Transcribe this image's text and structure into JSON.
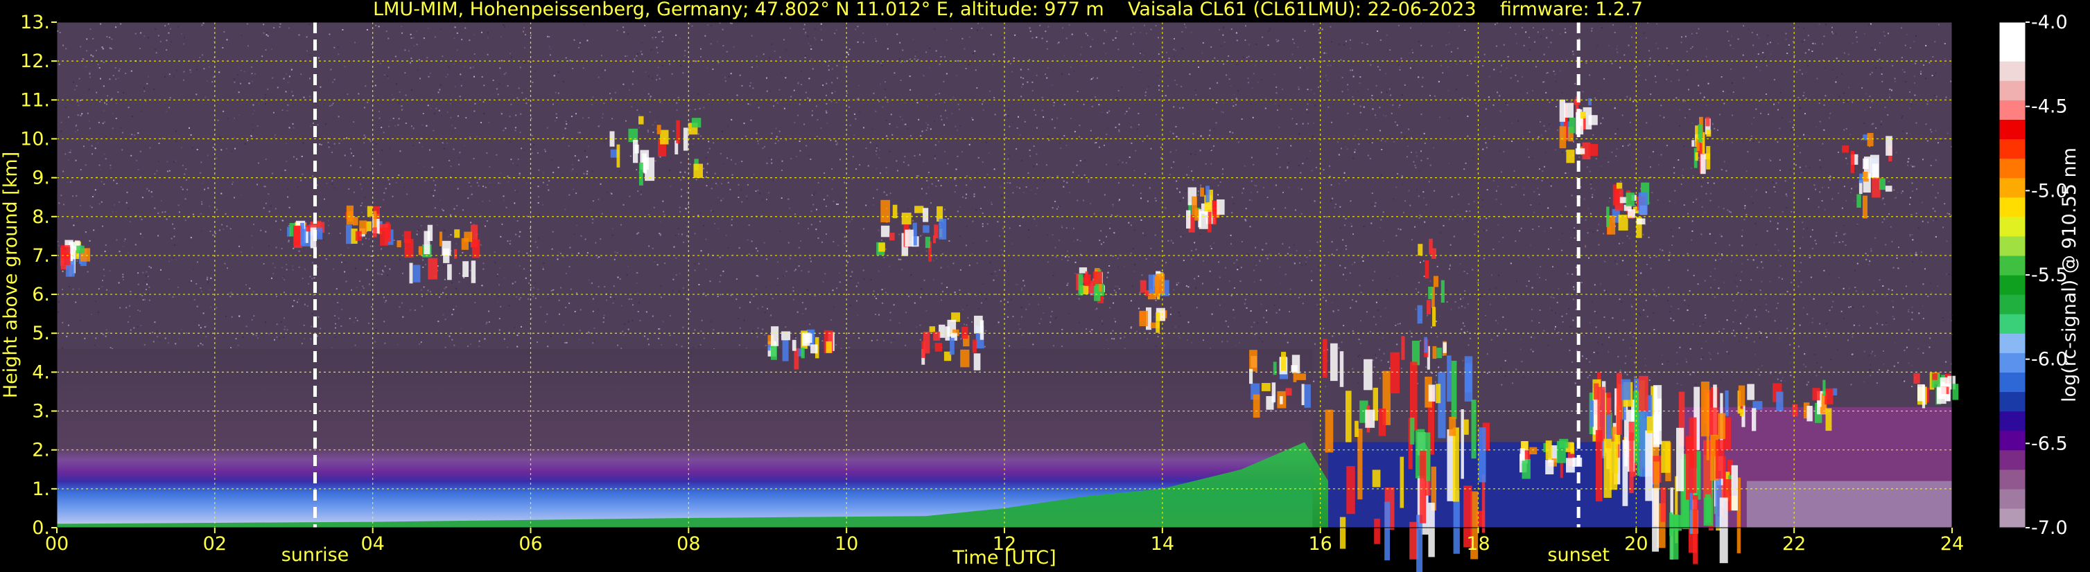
{
  "chart_data": {
    "type": "heatmap",
    "title": "LMU-MIM, Hohenpeissenberg, Germany; 47.802° N 11.012° E, altitude: 977 m    Vaisala CL61 (CL61LMU): 22-06-2023    firmware: 1.2.7",
    "xlabel": "Time [UTC]",
    "ylabel": "Height above ground [km]",
    "xlim": [
      0,
      24
    ],
    "ylim": [
      0,
      13
    ],
    "x_ticks": [
      "00",
      "02",
      "04",
      "06",
      "08",
      "10",
      "12",
      "14",
      "16",
      "18",
      "20",
      "22",
      "24"
    ],
    "y_ticks": [
      "0.",
      "1.",
      "2.",
      "3.",
      "4.",
      "5.",
      "6.",
      "7.",
      "8.",
      "9.",
      "10.",
      "11.",
      "12.",
      "13."
    ],
    "grid": true,
    "grid_color": "#ffff00",
    "events": [
      {
        "label": "sunrise",
        "time_h": 3.27
      },
      {
        "label": "sunset",
        "time_h": 19.27
      }
    ],
    "colorbar": {
      "label": "log(rc-signal) @ 910.55 nm",
      "range": [
        -7.0,
        -4.0
      ],
      "ticks": [
        "-4.0",
        "-4.5",
        "-5.0",
        "-5.5",
        "-6.0",
        "-6.5",
        "-7.0"
      ],
      "colors": [
        "#b59ab5",
        "#a07aa0",
        "#90588f",
        "#7a2b86",
        "#5a0096",
        "#2d0a9c",
        "#1a3aa8",
        "#2e68d6",
        "#5a92ee",
        "#8ab8f4",
        "#3ad07a",
        "#20b040",
        "#10a020",
        "#40c040",
        "#a0e040",
        "#e0f020",
        "#ffdd00",
        "#ffaa00",
        "#ff7700",
        "#ff3300",
        "#ee0000",
        "#ff8080",
        "#f0b0b0",
        "#f0d8d8",
        "#ffffff",
        "#ffffff"
      ]
    },
    "cloud_features": [
      {
        "t0": 0.0,
        "t1": 0.3,
        "h0": 7.0,
        "h1": 7.4,
        "kind": "patch"
      },
      {
        "t0": 2.9,
        "t1": 3.3,
        "h0": 7.7,
        "h1": 7.9,
        "kind": "patch"
      },
      {
        "t0": 3.6,
        "t1": 4.2,
        "h0": 7.6,
        "h1": 8.3,
        "kind": "patch"
      },
      {
        "t0": 4.3,
        "t1": 5.3,
        "h0": 6.6,
        "h1": 7.8,
        "kind": "patch"
      },
      {
        "t0": 7.0,
        "t1": 8.1,
        "h0": 9.3,
        "h1": 10.6,
        "kind": "patch"
      },
      {
        "t0": 9.0,
        "t1": 9.8,
        "h0": 4.6,
        "h1": 5.2,
        "kind": "patch"
      },
      {
        "t0": 10.3,
        "t1": 11.3,
        "h0": 7.3,
        "h1": 8.5,
        "kind": "patch"
      },
      {
        "t0": 10.9,
        "t1": 11.9,
        "h0": 4.4,
        "h1": 5.6,
        "kind": "patch"
      },
      {
        "t0": 12.9,
        "t1": 13.2,
        "h0": 6.2,
        "h1": 6.7,
        "kind": "patch"
      },
      {
        "t0": 13.7,
        "t1": 14.0,
        "h0": 5.1,
        "h1": 6.8,
        "kind": "patch"
      },
      {
        "t0": 14.3,
        "t1": 14.7,
        "h0": 7.9,
        "h1": 8.8,
        "kind": "patch"
      },
      {
        "t0": 15.0,
        "t1": 15.8,
        "h0": 3.3,
        "h1": 4.6,
        "kind": "patch"
      },
      {
        "t0": 16.0,
        "t1": 18.1,
        "h0": 0.0,
        "h1": 5.0,
        "kind": "convective"
      },
      {
        "t0": 17.2,
        "t1": 17.6,
        "h0": 4.5,
        "h1": 7.8,
        "kind": "streak"
      },
      {
        "t0": 18.5,
        "t1": 19.2,
        "h0": 1.7,
        "h1": 2.3,
        "kind": "patch"
      },
      {
        "t0": 19.0,
        "t1": 19.4,
        "h0": 9.7,
        "h1": 11.1,
        "kind": "patch"
      },
      {
        "t0": 19.4,
        "t1": 20.2,
        "h0": 2.2,
        "h1": 4.0,
        "kind": "convective"
      },
      {
        "t0": 19.6,
        "t1": 20.1,
        "h0": 7.9,
        "h1": 8.9,
        "kind": "patch"
      },
      {
        "t0": 20.2,
        "t1": 21.3,
        "h0": 0.3,
        "h1": 3.8,
        "kind": "convective"
      },
      {
        "t0": 20.7,
        "t1": 20.9,
        "h0": 9.5,
        "h1": 10.6,
        "kind": "streak"
      },
      {
        "t0": 21.2,
        "t1": 22.5,
        "h0": 3.0,
        "h1": 3.8,
        "kind": "patch"
      },
      {
        "t0": 22.6,
        "t1": 23.2,
        "h0": 8.4,
        "h1": 10.2,
        "kind": "patch"
      },
      {
        "t0": 23.5,
        "t1": 24.0,
        "h0": 3.6,
        "h1": 4.0,
        "kind": "patch"
      }
    ]
  }
}
